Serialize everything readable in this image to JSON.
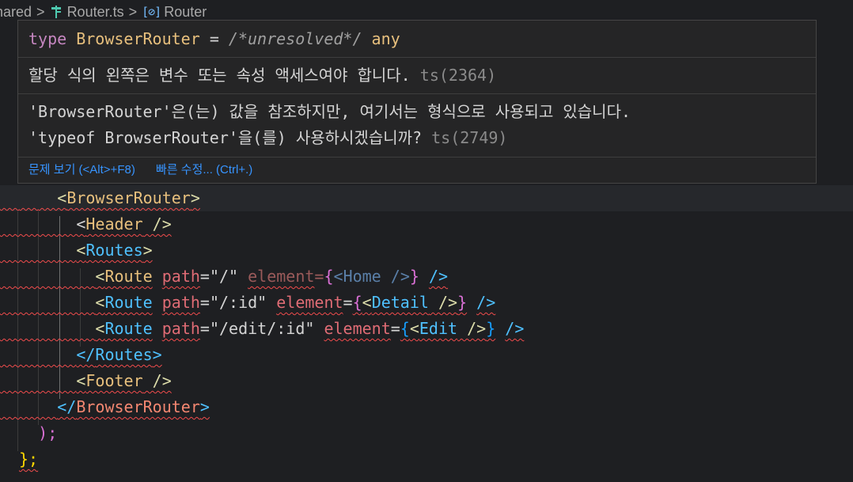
{
  "breadcrumb": {
    "segment1": "hared",
    "sep": ">",
    "file": "Router.ts",
    "symbol_icon": "[⊘]",
    "symbol": "Router",
    "file_icon": "typescript-icon"
  },
  "hover": {
    "signature": {
      "keyword": "type",
      "name": "BrowserRouter",
      "eq": "=",
      "comment": "/*unresolved*/",
      "type": "any"
    },
    "messages": [
      {
        "text": "할당 식의 왼쪽은 변수 또는 속성 액세스여야 합니다.",
        "code": "ts(2364)"
      },
      {
        "line1": "'BrowserRouter'은(는) 값을 참조하지만, 여기서는 형식으로 사용되고 있습니다.",
        "line2": "'typeof BrowserRouter'을(를) 사용하시겠습니까?",
        "code": "ts(2749)"
      }
    ],
    "actions": {
      "view_problem": "문제 보기 (<Alt>+F8)",
      "quick_fix": "빠른 수정... (Ctrl+.)"
    }
  },
  "code": {
    "browserRouterOpen": "BrowserRouter",
    "header": "Header",
    "routes": "Routes",
    "route": "Route",
    "path_attr": "path",
    "element_attr": "element",
    "path1": "\"/\"",
    "path2": "\"/:id\"",
    "path3": "\"/edit/:id\"",
    "home": "Home",
    "detail": "Detail",
    "edit": "Edit",
    "footer": "Footer",
    "close_paren": ");",
    "close_brace": "};"
  },
  "colors": {
    "background": "#1e1f22",
    "squiggle": "#f14c4c",
    "link": "#3794ff"
  }
}
